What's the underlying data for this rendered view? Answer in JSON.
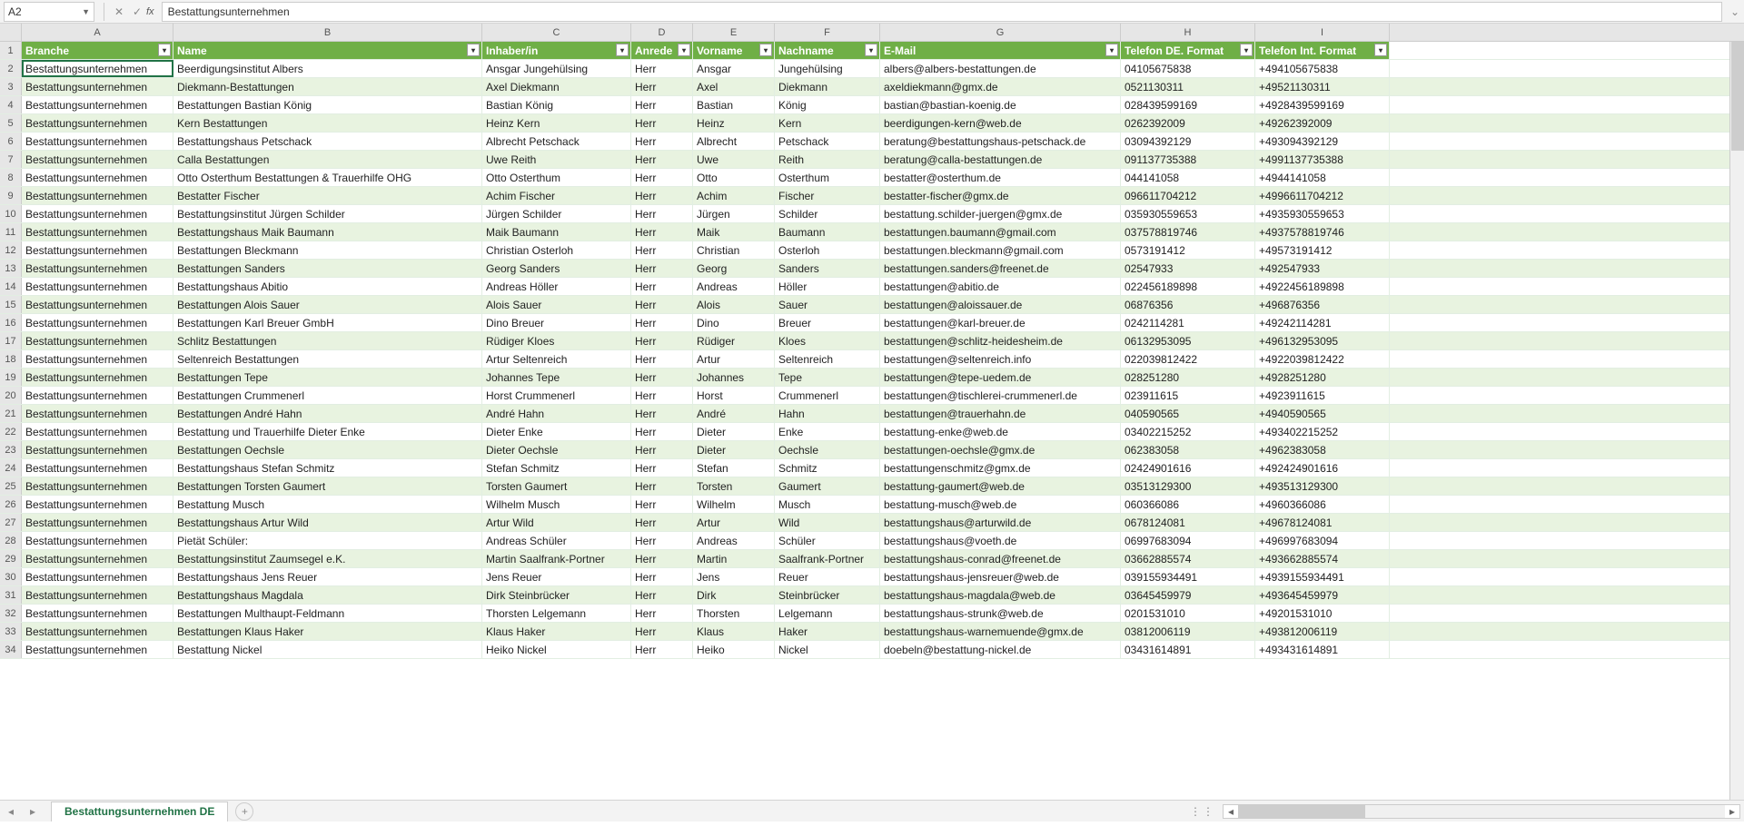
{
  "formula_bar": {
    "cell_ref": "A2",
    "cancel_icon": "✕",
    "confirm_icon": "✓",
    "fx_label": "fx",
    "formula_value": "Bestattungsunternehmen",
    "expand_icon": "⌄"
  },
  "columns": [
    "A",
    "B",
    "C",
    "D",
    "E",
    "F",
    "G",
    "H",
    "I"
  ],
  "column_widths": [
    "wA",
    "wB",
    "wC",
    "wD",
    "wE",
    "wF",
    "wG",
    "wH",
    "wI"
  ],
  "headers": [
    "Branche",
    "Name",
    "Inhaber/in",
    "Anrede",
    "Vorname",
    "Nachname",
    "E-Mail",
    "Telefon DE. Format",
    "Telefon Int. Format"
  ],
  "filter_icon": "▾",
  "sheet_tab": {
    "name": "Bestattungsunternehmen DE",
    "add_icon": "+",
    "nav_left": "◂",
    "nav_right": "▸",
    "dots": "⋮⋮"
  },
  "selected_cell": {
    "row": 2,
    "col": 0
  },
  "rows": [
    [
      "Bestattungsunternehmen",
      "Beerdigungsinstitut Albers",
      "Ansgar Jungehülsing",
      "Herr",
      "Ansgar",
      "Jungehülsing",
      "albers@albers-bestattungen.de",
      "04105675838",
      "+494105675838"
    ],
    [
      "Bestattungsunternehmen",
      "Diekmann-Bestattungen",
      "Axel Diekmann",
      "Herr",
      "Axel",
      "Diekmann",
      "axeldiekmann@gmx.de",
      "0521130311",
      "+49521130311"
    ],
    [
      "Bestattungsunternehmen",
      "Bestattungen Bastian König",
      "Bastian König",
      "Herr",
      "Bastian",
      "König",
      "bastian@bastian-koenig.de",
      "028439599169",
      "+4928439599169"
    ],
    [
      "Bestattungsunternehmen",
      "Kern Bestattungen",
      "Heinz Kern",
      "Herr",
      "Heinz",
      "Kern",
      "beerdigungen-kern@web.de",
      "0262392009",
      "+49262392009"
    ],
    [
      "Bestattungsunternehmen",
      "Bestattungshaus Petschack",
      "Albrecht Petschack",
      "Herr",
      "Albrecht",
      "Petschack",
      "beratung@bestattungshaus-petschack.de",
      "03094392129",
      "+493094392129"
    ],
    [
      "Bestattungsunternehmen",
      "Calla Bestattungen",
      "Uwe Reith",
      "Herr",
      "Uwe",
      "Reith",
      "beratung@calla-bestattungen.de",
      "091137735388",
      "+4991137735388"
    ],
    [
      "Bestattungsunternehmen",
      "Otto Osterthum Bestattungen & Trauerhilfe OHG",
      "Otto Osterthum",
      "Herr",
      "Otto",
      "Osterthum",
      "bestatter@osterthum.de",
      "044141058",
      "+4944141058"
    ],
    [
      "Bestattungsunternehmen",
      "Bestatter Fischer",
      "Achim Fischer",
      "Herr",
      "Achim",
      "Fischer",
      "bestatter-fischer@gmx.de",
      "096611704212",
      "+4996611704212"
    ],
    [
      "Bestattungsunternehmen",
      "Bestattungsinstitut Jürgen Schilder",
      "Jürgen Schilder",
      "Herr",
      "Jürgen",
      "Schilder",
      "bestattung.schilder-juergen@gmx.de",
      "035930559653",
      "+4935930559653"
    ],
    [
      "Bestattungsunternehmen",
      "Bestattungshaus Maik Baumann",
      "Maik Baumann",
      "Herr",
      "Maik",
      "Baumann",
      "bestattungen.baumann@gmail.com",
      "037578819746",
      "+4937578819746"
    ],
    [
      "Bestattungsunternehmen",
      "Bestattungen Bleckmann",
      "Christian Osterloh",
      "Herr",
      "Christian",
      "Osterloh",
      "bestattungen.bleckmann@gmail.com",
      "0573191412",
      "+49573191412"
    ],
    [
      "Bestattungsunternehmen",
      "Bestattungen Sanders",
      "Georg Sanders",
      "Herr",
      "Georg",
      "Sanders",
      "bestattungen.sanders@freenet.de",
      "02547933",
      "+492547933"
    ],
    [
      "Bestattungsunternehmen",
      "Bestattungshaus Abitio",
      "Andreas Höller",
      "Herr",
      "Andreas",
      "Höller",
      "bestattungen@abitio.de",
      "022456189898",
      "+4922456189898"
    ],
    [
      "Bestattungsunternehmen",
      "Bestattungen Alois Sauer",
      "Alois Sauer",
      "Herr",
      "Alois",
      "Sauer",
      "bestattungen@aloissauer.de",
      "06876356",
      "+496876356"
    ],
    [
      "Bestattungsunternehmen",
      "Bestattungen Karl Breuer GmbH",
      "Dino Breuer",
      "Herr",
      "Dino",
      "Breuer",
      "bestattungen@karl-breuer.de",
      "0242114281",
      "+49242114281"
    ],
    [
      "Bestattungsunternehmen",
      "Schlitz Bestattungen",
      "Rüdiger Kloes",
      "Herr",
      "Rüdiger",
      "Kloes",
      "bestattungen@schlitz-heidesheim.de",
      "06132953095",
      "+496132953095"
    ],
    [
      "Bestattungsunternehmen",
      "Seltenreich Bestattungen",
      "Artur Seltenreich",
      "Herr",
      "Artur",
      "Seltenreich",
      "bestattungen@seltenreich.info",
      "022039812422",
      "+4922039812422"
    ],
    [
      "Bestattungsunternehmen",
      "Bestattungen Tepe",
      "Johannes Tepe",
      "Herr",
      "Johannes",
      "Tepe",
      "bestattungen@tepe-uedem.de",
      "028251280",
      "+4928251280"
    ],
    [
      "Bestattungsunternehmen",
      "Bestattungen Crummenerl",
      "Horst Crummenerl",
      "Herr",
      "Horst",
      "Crummenerl",
      "bestattungen@tischlerei-crummenerl.de",
      "023911615",
      "+4923911615"
    ],
    [
      "Bestattungsunternehmen",
      "Bestattungen André Hahn",
      "André Hahn",
      "Herr",
      "André",
      "Hahn",
      "bestattungen@trauerhahn.de",
      "040590565",
      "+4940590565"
    ],
    [
      "Bestattungsunternehmen",
      "Bestattung und Trauerhilfe Dieter Enke",
      "Dieter Enke",
      "Herr",
      "Dieter",
      "Enke",
      "bestattung-enke@web.de",
      "03402215252",
      "+493402215252"
    ],
    [
      "Bestattungsunternehmen",
      "Bestattungen Oechsle",
      "Dieter Oechsle",
      "Herr",
      "Dieter",
      "Oechsle",
      "bestattungen-oechsle@gmx.de",
      "062383058",
      "+4962383058"
    ],
    [
      "Bestattungsunternehmen",
      "Bestattungshaus Stefan Schmitz",
      "Stefan Schmitz",
      "Herr",
      "Stefan",
      "Schmitz",
      "bestattungenschmitz@gmx.de",
      "02424901616",
      "+492424901616"
    ],
    [
      "Bestattungsunternehmen",
      "Bestattungen Torsten Gaumert",
      "Torsten Gaumert",
      "Herr",
      "Torsten",
      "Gaumert",
      "bestattung-gaumert@web.de",
      "03513129300",
      "+493513129300"
    ],
    [
      "Bestattungsunternehmen",
      "Bestattung Musch",
      "Wilhelm Musch",
      "Herr",
      "Wilhelm",
      "Musch",
      "bestattung-musch@web.de",
      "060366086",
      "+4960366086"
    ],
    [
      "Bestattungsunternehmen",
      "Bestattungshaus Artur Wild",
      "Artur Wild",
      "Herr",
      "Artur",
      "Wild",
      "bestattungshaus@arturwild.de",
      "0678124081",
      "+49678124081"
    ],
    [
      "Bestattungsunternehmen",
      "Pietät Schüler:",
      "Andreas Schüler",
      "Herr",
      "Andreas",
      "Schüler",
      "bestattungshaus@voeth.de",
      "06997683094",
      "+496997683094"
    ],
    [
      "Bestattungsunternehmen",
      "Bestattungsinstitut Zaumsegel e.K.",
      "Martin Saalfrank-Portner",
      "Herr",
      "Martin",
      "Saalfrank-Portner",
      "bestattungshaus-conrad@freenet.de",
      "03662885574",
      "+493662885574"
    ],
    [
      "Bestattungsunternehmen",
      "Bestattungshaus Jens Reuer",
      "Jens Reuer",
      "Herr",
      "Jens",
      "Reuer",
      "bestattungshaus-jensreuer@web.de",
      "039155934491",
      "+4939155934491"
    ],
    [
      "Bestattungsunternehmen",
      "Bestattungshaus Magdala",
      "Dirk Steinbrücker",
      "Herr",
      "Dirk",
      "Steinbrücker",
      "bestattungshaus-magdala@web.de",
      "03645459979",
      "+493645459979"
    ],
    [
      "Bestattungsunternehmen",
      "Bestattungen Multhaupt-Feldmann",
      "Thorsten Lelgemann",
      "Herr",
      "Thorsten",
      "Lelgemann",
      "bestattungshaus-strunk@web.de",
      "0201531010",
      "+49201531010"
    ],
    [
      "Bestattungsunternehmen",
      "Bestattungen Klaus Haker",
      "Klaus Haker",
      "Herr",
      "Klaus",
      "Haker",
      "bestattungshaus-warnemuende@gmx.de",
      "03812006119",
      "+493812006119"
    ],
    [
      "Bestattungsunternehmen",
      "Bestattung Nickel",
      "Heiko Nickel",
      "Herr",
      "Heiko",
      "Nickel",
      "doebeln@bestattung-nickel.de",
      "03431614891",
      "+493431614891"
    ]
  ]
}
